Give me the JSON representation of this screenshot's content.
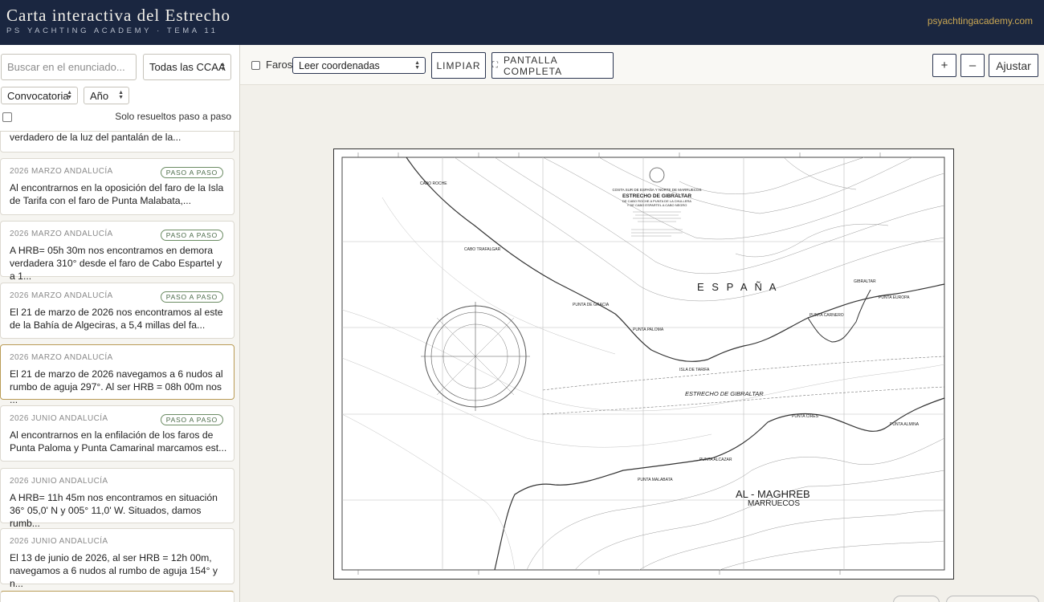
{
  "header": {
    "title": "Carta interactiva del Estrecho",
    "subtitle": "PS YACHTING ACADEMY · TEMA 11",
    "site": "psyachtingacademy.com"
  },
  "sidebar": {
    "search_placeholder": "Buscar en el enunciado...",
    "ccaa_value": "Todas las CCAA",
    "convocatoria_value": "Convocatoria",
    "ano_value": "Año",
    "solo_label": "Solo resueltos paso a paso",
    "first_card_text": "verdadero de la luz del pantalán de la...",
    "cards": [
      {
        "meta": "2026 MARZO ANDALUCÍA",
        "badge": "PASO A PASO",
        "text": "Al encontrarnos en la oposición del faro de la Isla de Tarifa con el faro de Punta Malabata,..."
      },
      {
        "meta": "2026 MARZO ANDALUCÍA",
        "badge": "PASO A PASO",
        "text": "A HRB= 05h 30m nos encontramos en demora verdadera 310° desde el faro de Cabo Espartel y a 1..."
      },
      {
        "meta": "2026 MARZO ANDALUCÍA",
        "badge": "PASO A PASO",
        "text": "El 21 de marzo de 2026 nos encontramos al este de la Bahía de Algeciras, a 5,4 millas del fa..."
      },
      {
        "meta": "2026 MARZO ANDALUCÍA",
        "badge": "",
        "text": "El 21 de marzo de 2026 navegamos a 6 nudos al rumbo de aguja 297°. Al ser HRB = 08h 00m nos ..."
      },
      {
        "meta": "2026 JUNIO ANDALUCÍA",
        "badge": "PASO A PASO",
        "text": "Al encontrarnos en la enfilación de los faros de Punta Paloma y Punta Camarinal marcamos est..."
      },
      {
        "meta": "2026 JUNIO ANDALUCÍA",
        "badge": "",
        "text": "A HRB= 11h 45m nos encontramos en situación 36° 05,0' N y 005° 11,0' W. Situados, damos rumb..."
      },
      {
        "meta": "2026 JUNIO ANDALUCÍA",
        "badge": "",
        "text": "El 13 de junio de 2026, al ser HRB = 12h 00m, navegamos a 6 nudos al rumbo de aguja 154° y n..."
      }
    ]
  },
  "toolbar": {
    "faros_label": "Faros",
    "coord_value": "Leer coordenadas",
    "limpiar_label": "LIMPIAR",
    "fullscreen_label": "PANTALLA COMPLETA",
    "zoom_in_label": "+",
    "zoom_out_label": "–",
    "ajustar_label": "Ajustar"
  },
  "chart": {
    "title_block": [
      "COSTA SUR DE ESPAÑA Y NORTE DE MARRUECOS",
      "ESTRECHO DE GIBRALTAR",
      "DE CABO ROCHE A PUNTA DE LA CHULLERA",
      "Y DE CABO ESPARTEL A CABO NEGRO"
    ],
    "labels": {
      "espana": "E S P A Ñ A",
      "maghreb": "AL - MAGHREB",
      "marruecos": "MARRUECOS",
      "estrecho": "ESTRECHO   DE   GIBRALTAR",
      "cabo_roche": "CABO ROCHE",
      "cabo_trafalgar": "CABO TRAFALGAR",
      "punta_gracia": "PUNTA DE GRACIA",
      "punta_paloma": "PUNTA PALOMA",
      "isla_tarifa": "ISLA DE TARIFA",
      "punta_carnero": "PUNTA CARNERO",
      "punta_europa": "PUNTA EUROPA",
      "gibraltar": "GIBRALTAR",
      "punta_cires": "PUNTA CIRES",
      "punta_almina": "PUNTA ALMINA",
      "punta_malabata": "PUNTA MALABATA",
      "punta_alcazar": "PUNTA ALCAZAR"
    }
  }
}
